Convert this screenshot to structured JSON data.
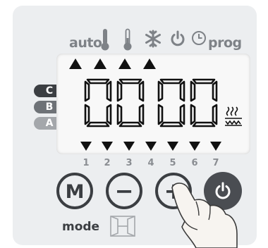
{
  "header": {
    "auto_label": "auto",
    "prog_label": "prog",
    "icons": [
      "thermometer-comfort-icon",
      "thermometer-eco-icon",
      "snowflake-frost-icon",
      "standby-power-icon",
      "clock-icon"
    ]
  },
  "lcd": {
    "top_indicators_count": 4,
    "digits": "0000",
    "heater_icon": "heating-element-icon"
  },
  "profile_tabs": [
    "C",
    "B",
    "A"
  ],
  "days": [
    "1",
    "2",
    "3",
    "4",
    "5",
    "6",
    "7"
  ],
  "controls": {
    "mode_button": "M",
    "mode_label": "mode",
    "minus_button": "−",
    "plus_button": "+",
    "power_button_icon": "power-icon",
    "window_icon": "open-window-icon"
  },
  "colors": {
    "panel": "#eceef0",
    "icon_gray": "#7e8287",
    "lcd_bg": "#f8f8f8",
    "segment": "#111111",
    "tab_c": "#3b3e42",
    "tab_b": "#6e7277",
    "tab_a": "#a4a7ab",
    "power_button": "#4a4d52"
  }
}
